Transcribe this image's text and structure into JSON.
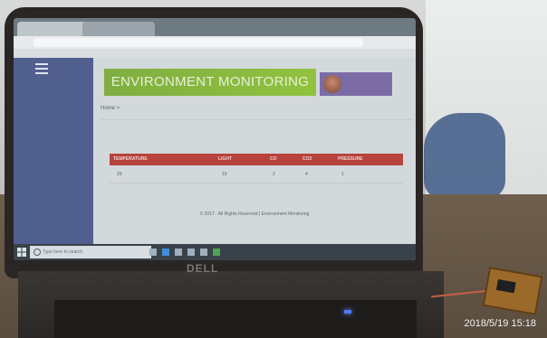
{
  "browser": {
    "tabs": [
      "",
      ""
    ],
    "address": ""
  },
  "dashboard": {
    "banner_title": "ENVIRONMENT MONITORING",
    "user": {
      "name": "",
      "role": ""
    },
    "breadcrumb": "Home >",
    "table": {
      "headers": [
        "TEMPERATURE",
        "LIGHT",
        "CO",
        "CO2",
        "PRESSURE"
      ],
      "row": [
        "29",
        "19",
        "2",
        "4",
        "1"
      ]
    },
    "footer": "© 2017 . All Rights Reserved | Environment Monitoring"
  },
  "taskbar": {
    "search_placeholder": "Type here to search"
  },
  "photo": {
    "brand": "DELL",
    "timestamp": "2018/5/19  15:18"
  }
}
